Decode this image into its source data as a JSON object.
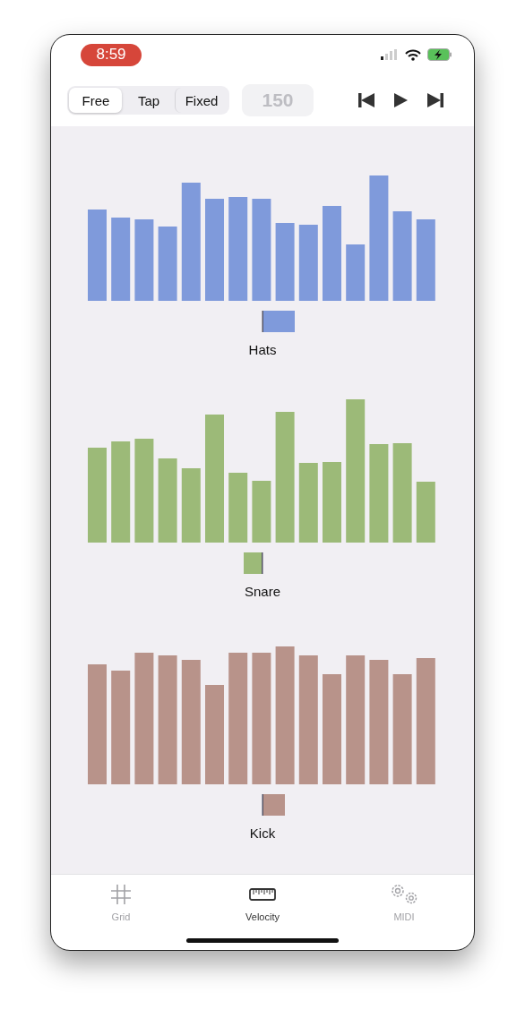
{
  "status_bar": {
    "time": "8:59"
  },
  "toolbar": {
    "modes": [
      {
        "label": "Free",
        "selected": true
      },
      {
        "label": "Tap",
        "selected": false
      },
      {
        "label": "Fixed",
        "selected": false
      }
    ],
    "tempo": {
      "value": "150",
      "disabled": true
    }
  },
  "tracks": [
    {
      "name": "Hats",
      "color": "#7f9adb"
    },
    {
      "name": "Snare",
      "color": "#9cba78"
    },
    {
      "name": "Kick",
      "color": "#b8938a"
    }
  ],
  "tab_bar": [
    {
      "label": "Grid",
      "kind": "grid",
      "selected": false
    },
    {
      "label": "Velocity",
      "kind": "ruler",
      "selected": true
    },
    {
      "label": "MIDI",
      "kind": "gears",
      "selected": false
    }
  ]
}
